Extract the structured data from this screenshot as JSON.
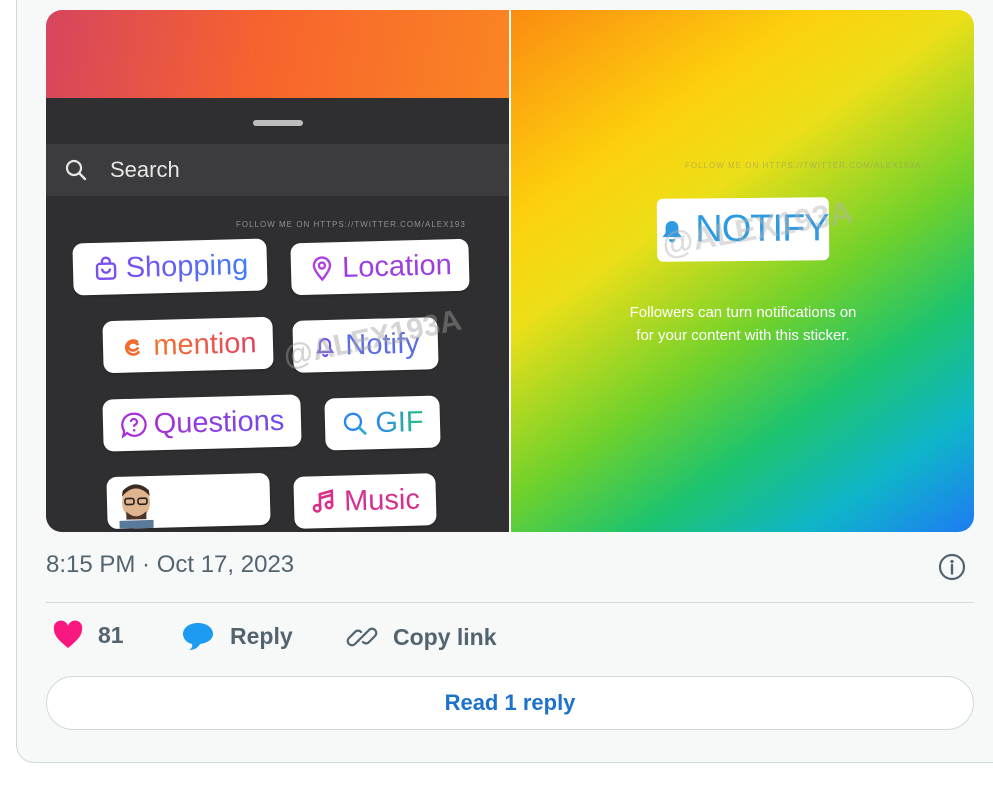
{
  "media": {
    "left_panel": {
      "search_placeholder": "Search",
      "watermark": "FOLLOW ME ON HTTPS://TWITTER.COM/ALEX193",
      "stickers": {
        "shopping": "Shopping",
        "location": "Location",
        "mention": "mention",
        "notify": "Notify",
        "questions": "Questions",
        "gif": "GIF",
        "music": "Music"
      },
      "overlay_watermark": "@ALEX193A"
    },
    "right_panel": {
      "watermark": "FOLLOW ME ON HTTPS://TWITTER.COM/ALEX193A",
      "sticker_label": "NOTIFY",
      "overlay_watermark": "@ALEX193A",
      "caption_line1": "Followers can turn notifications on",
      "caption_line2": "for your content with this sticker."
    }
  },
  "tweet": {
    "timestamp": "8:15 PM · Oct 17, 2023",
    "like_count": "81",
    "reply_label": "Reply",
    "copy_link_label": "Copy link",
    "read_replies_label": "Read 1 reply"
  },
  "colors": {
    "like": "#f91880",
    "reply": "#1d9bf0",
    "link_text": "#1d73c9",
    "meta_text": "#536471"
  }
}
